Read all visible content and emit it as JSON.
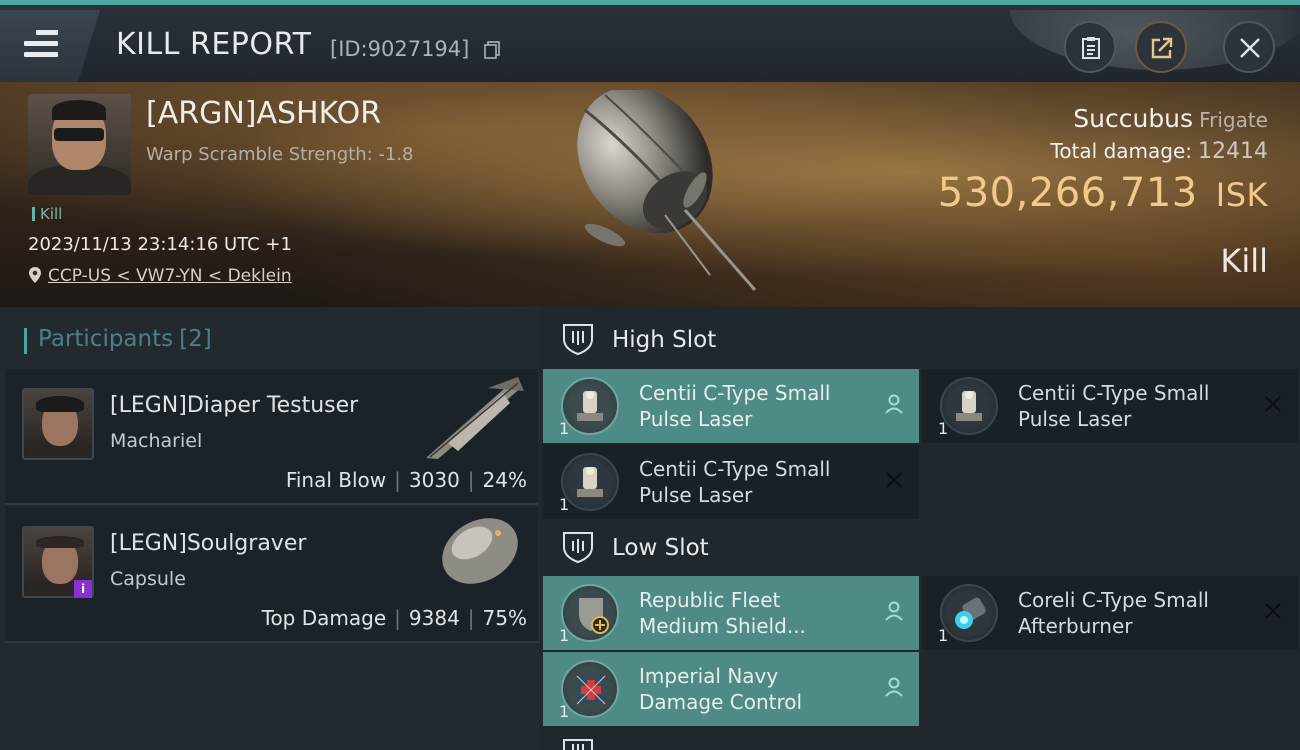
{
  "header": {
    "title": "KILL REPORT",
    "id_label": "[ID:9027194]"
  },
  "victim": {
    "name": "[ARGN]ASHKOR",
    "subtitle": "Warp Scramble Strength: -1.8",
    "tag": "Kill",
    "datetime": "2023/11/13 23:14:16 UTC +1",
    "location": "CCP-US < VW7-YN < Deklein",
    "ship_name": "Succubus",
    "ship_class": "Frigate",
    "total_damage_label": "Total damage:",
    "total_damage": "12414",
    "isk_value": "530,266,713",
    "isk_unit": "ISK",
    "result": "Kill"
  },
  "participants": {
    "title": "Participants",
    "count": "[2]",
    "items": [
      {
        "name": "[LEGN]Diaper Testuser",
        "ship": "Machariel",
        "role": "Final Blow",
        "damage": "3030",
        "percent": "24%"
      },
      {
        "name": "[LEGN]Soulgraver",
        "ship": "Capsule",
        "role": "Top Damage",
        "damage": "9384",
        "percent": "75%",
        "badge": "i"
      }
    ]
  },
  "slots": {
    "high": {
      "label": "High Slot",
      "modules": [
        {
          "name": "Centii C-Type Small Pulse Laser",
          "qty": "1",
          "status": "fitted"
        },
        {
          "name": "Centii C-Type Small Pulse Laser",
          "qty": "1",
          "status": "destroyed"
        },
        {
          "name": "Centii C-Type Small Pulse Laser",
          "qty": "1",
          "status": "destroyed"
        }
      ]
    },
    "low": {
      "label": "Low Slot",
      "modules": [
        {
          "name": "Republic Fleet Medium Shield...",
          "qty": "1",
          "status": "fitted"
        },
        {
          "name": "Coreli C-Type Small Afterburner",
          "qty": "1",
          "status": "destroyed"
        },
        {
          "name": "Imperial Navy Damage Control",
          "qty": "1",
          "status": "fitted"
        }
      ]
    }
  },
  "icons": {
    "menu": "hamburger-icon",
    "copy": "copy-icon",
    "report": "clipboard-icon",
    "share": "share-icon",
    "close": "close-icon",
    "location": "location-pin-icon",
    "slot": "slot-shield-icon",
    "fitted_status": "person-icon",
    "destroyed_status": "x-icon"
  },
  "colors": {
    "accent": "#4aa8a0",
    "isk": "#f3c98a",
    "fitted_bg": "#4f8b86",
    "badge": "#8a2fd2"
  }
}
